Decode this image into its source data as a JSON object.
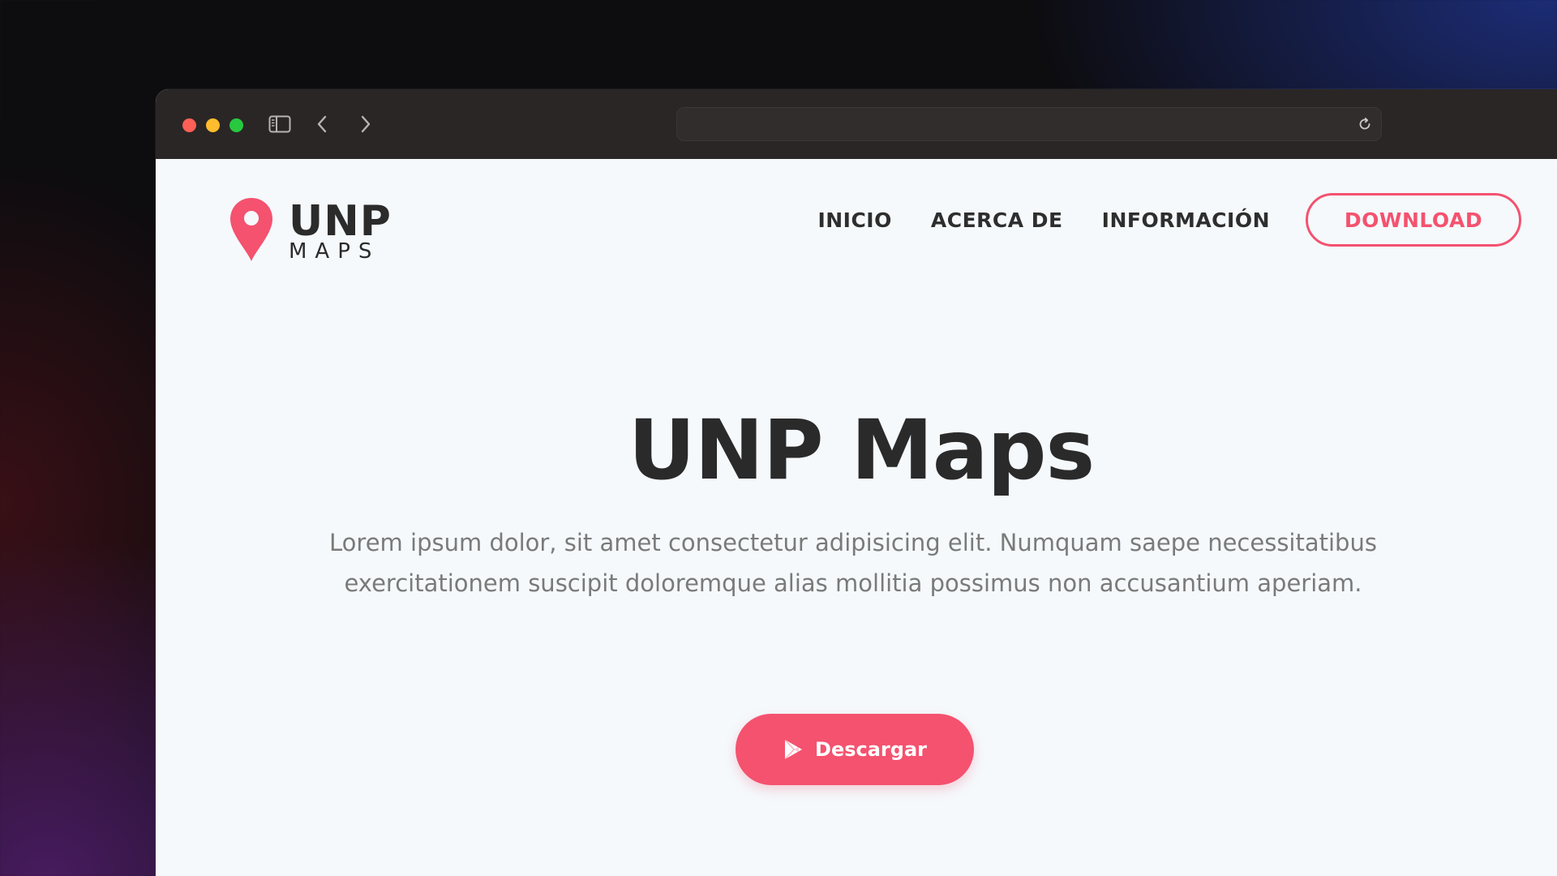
{
  "browser": {
    "url": "",
    "icons": {
      "sidebar": "sidebar-toggle-icon",
      "back": "chevron-left-icon",
      "forward": "chevron-right-icon",
      "reload": "reload-icon"
    },
    "traffic_colors": [
      "#fe5f57",
      "#febc2e",
      "#28c840"
    ]
  },
  "site": {
    "logo": {
      "main": "UNP",
      "sub": "MAPS",
      "icon": "map-pin-icon"
    },
    "nav": [
      {
        "label": "INICIO"
      },
      {
        "label": "ACERCA DE"
      },
      {
        "label": "INFORMACIÓN"
      }
    ],
    "download_label": "DOWNLOAD"
  },
  "hero": {
    "title": "UNP Maps",
    "text": "Lorem ipsum dolor, sit amet consectetur adipisicing elit. Numquam saepe necessitatibus exercitationem suscipit doloremque alias mollitia possimus non accusantium aperiam.",
    "cta_label": "Descargar",
    "cta_icon": "play-store-icon"
  },
  "colors": {
    "accent": "#f4526f",
    "heading": "#2a2a2a",
    "body_text": "#7a7a7a",
    "page_bg": "#f5f9fc",
    "toolbar_bg": "#2a2625"
  }
}
